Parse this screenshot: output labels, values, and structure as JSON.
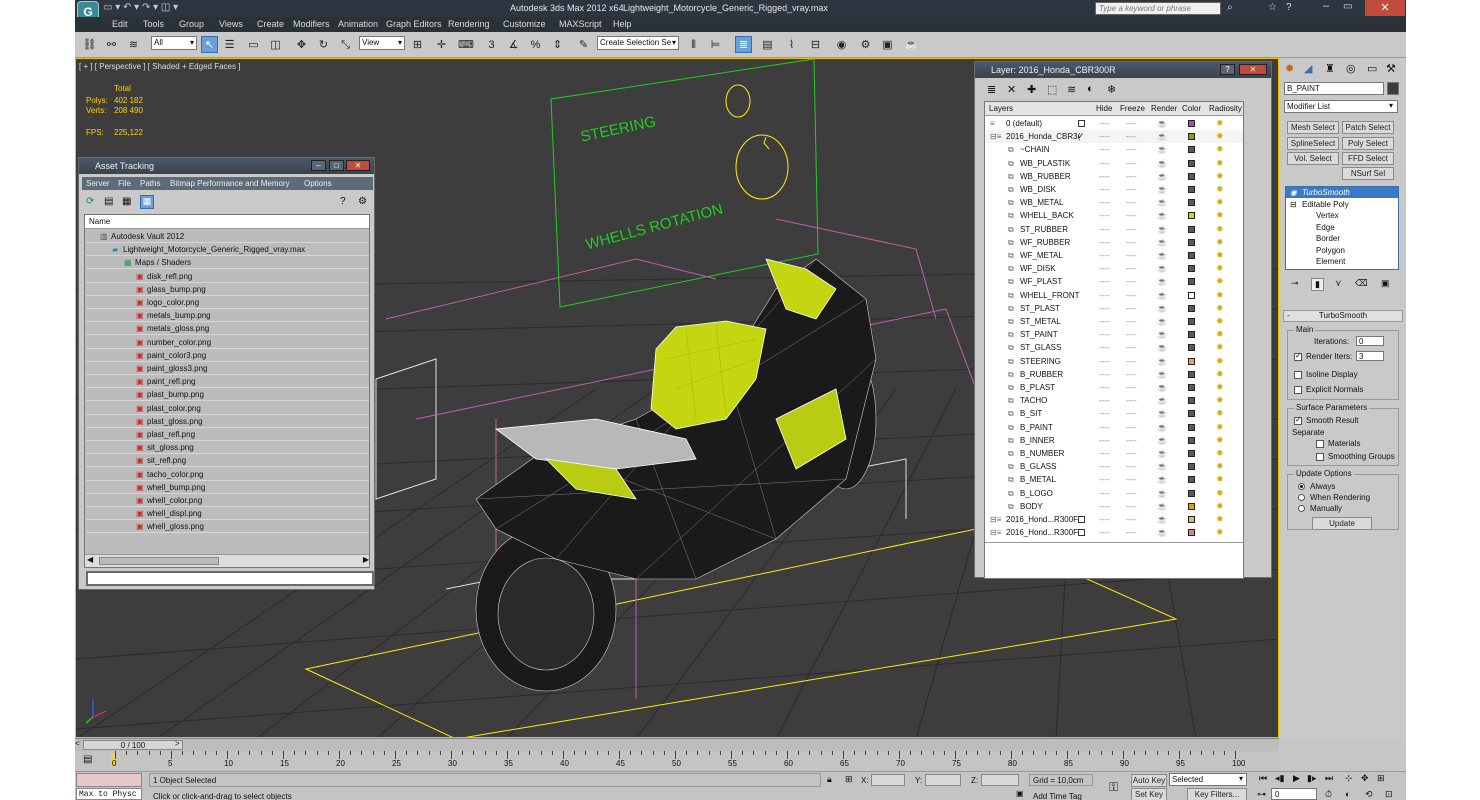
{
  "titlebar": {
    "app_title": "Autodesk 3ds Max  2012 x64",
    "file_title": "Lightweight_Motorcycle_Generic_Rigged_vray.max",
    "search_placeholder": "Type a keyword or phrase"
  },
  "menu": [
    "Edit",
    "Tools",
    "Group",
    "Views",
    "Create",
    "Modifiers",
    "Animation",
    "Graph Editors",
    "Rendering",
    "Customize",
    "MAXScript",
    "Help"
  ],
  "toolbar": {
    "selection_filter": "All",
    "ref_coord": "View",
    "named_selection": "Create Selection Se"
  },
  "viewport": {
    "label": "[ + ] [ Perspective ] [ Shaded + Edged Faces ]",
    "stats_header": "Total",
    "polys_label": "Polys:",
    "polys_value": "402 182",
    "verts_label": "Verts:",
    "verts_value": "208 490",
    "fps_label": "FPS:",
    "fps_value": "225,122",
    "text_steering": "STEERING",
    "text_wheels": "WHELLS ROTATION"
  },
  "asset_tracking": {
    "title": "Asset Tracking",
    "menu": [
      "Server",
      "File",
      "Paths",
      "Bitmap Performance and Memory",
      "Options"
    ],
    "column_name": "Name",
    "vault": "Autodesk Vault 2012",
    "file": "Lightweight_Motorcycle_Generic_Rigged_vray.max",
    "folder": "Maps / Shaders",
    "maps": [
      "disk_refl.png",
      "glass_bump.png",
      "logo_color.png",
      "metals_bump.png",
      "metals_gloss.png",
      "number_color.png",
      "paint_color3.png",
      "paint_gloss3.png",
      "paint_refl.png",
      "plast_bump.png",
      "plast_color.png",
      "plast_gloss.png",
      "plast_refl.png",
      "sit_gloss.png",
      "sit_refl.png",
      "tacho_color.png",
      "whell_bump.png",
      "whell_color.png",
      "whell_displ.png",
      "whell_gloss.png"
    ]
  },
  "layer_window": {
    "title": "Layer: 2016_Honda_CBR300R",
    "columns": [
      "Layers",
      "Hide",
      "Freeze",
      "Render",
      "Color",
      "Radiosity"
    ],
    "layers": [
      {
        "name": "0 (default)",
        "indent": 0,
        "color": "#c040c0",
        "check": true
      },
      {
        "name": "2016_Honda_CBR3(",
        "indent": 0,
        "color": "#8a9a20",
        "check": false,
        "current": true
      },
      {
        "name": "~CHAIN",
        "indent": 1,
        "color": "#5a5a5a"
      },
      {
        "name": "WB_PLASTIK",
        "indent": 1,
        "color": "#5a5a5a"
      },
      {
        "name": "WB_RUBBER",
        "indent": 1,
        "color": "#5a5a5a"
      },
      {
        "name": "WB_DISK",
        "indent": 1,
        "color": "#5a5a5a"
      },
      {
        "name": "WB_METAL",
        "indent": 1,
        "color": "#5a5a5a"
      },
      {
        "name": "WHELL_BACK",
        "indent": 1,
        "color": "#b8e800"
      },
      {
        "name": "ST_RUBBER",
        "indent": 1,
        "color": "#5a5a5a"
      },
      {
        "name": "WF_RUBBER",
        "indent": 1,
        "color": "#5a5a5a"
      },
      {
        "name": "WF_METAL",
        "indent": 1,
        "color": "#5a5a5a"
      },
      {
        "name": "WF_DISK",
        "indent": 1,
        "color": "#5a5a5a"
      },
      {
        "name": "WF_PLAST",
        "indent": 1,
        "color": "#5a5a5a"
      },
      {
        "name": "WHELL_FRONT",
        "indent": 1,
        "color": "#ffffff"
      },
      {
        "name": "ST_PLAST",
        "indent": 1,
        "color": "#5a5a5a"
      },
      {
        "name": "ST_METAL",
        "indent": 1,
        "color": "#5a5a5a"
      },
      {
        "name": "ST_PAINT",
        "indent": 1,
        "color": "#5a5a5a"
      },
      {
        "name": "ST_GLASS",
        "indent": 1,
        "color": "#5a5a5a"
      },
      {
        "name": "STEERING",
        "indent": 1,
        "color": "#e0a070"
      },
      {
        "name": "B_RUBBER",
        "indent": 1,
        "color": "#5a5a5a"
      },
      {
        "name": "B_PLAST",
        "indent": 1,
        "color": "#5a5a5a"
      },
      {
        "name": "TACHO",
        "indent": 1,
        "color": "#5a5a5a"
      },
      {
        "name": "B_SIT",
        "indent": 1,
        "color": "#5a5a5a"
      },
      {
        "name": "B_PAINT",
        "indent": 1,
        "color": "#5a5a5a"
      },
      {
        "name": "B_INNER",
        "indent": 1,
        "color": "#5a5a5a"
      },
      {
        "name": "B_NUMBER",
        "indent": 1,
        "color": "#5a5a5a"
      },
      {
        "name": "B_GLASS",
        "indent": 1,
        "color": "#5a5a5a"
      },
      {
        "name": "B_METAL",
        "indent": 1,
        "color": "#5a5a5a"
      },
      {
        "name": "B_LOGO",
        "indent": 1,
        "color": "#5a5a5a"
      },
      {
        "name": "BODY",
        "indent": 1,
        "color": "#e0a000"
      },
      {
        "name": "2016_Hond...R300F",
        "indent": 0,
        "color": "#d0c060",
        "check": true
      },
      {
        "name": "2016_Hond...R300F",
        "indent": 0,
        "color": "#e08080",
        "check": true
      }
    ]
  },
  "command_panel": {
    "object_name": "B_PAINT",
    "modifier_list": "Modifier List",
    "buttons": [
      "Mesh Select",
      "Patch Select",
      "SplineSelect",
      "Poly Select",
      "Vol. Select",
      "FFD Select",
      "NSurf Sel"
    ],
    "stack": [
      {
        "label": "TurboSmooth",
        "level": 0,
        "selected": true
      },
      {
        "label": "Editable Poly",
        "level": 0
      },
      {
        "label": "Vertex",
        "level": 1
      },
      {
        "label": "Edge",
        "level": 1
      },
      {
        "label": "Border",
        "level": 1
      },
      {
        "label": "Polygon",
        "level": 1
      },
      {
        "label": "Element",
        "level": 1
      }
    ],
    "rollout_title": "TurboSmooth",
    "main_label": "Main",
    "iterations_label": "Iterations:",
    "iterations_value": "0",
    "render_iters_label": "Render Iters:",
    "render_iters_value": "3",
    "isoline_label": "Isoline Display",
    "explicit_label": "Explicit Normals",
    "surface_label": "Surface Parameters",
    "smooth_label": "Smooth Result",
    "separate_label": "Separate",
    "materials_label": "Materials",
    "smoothing_label": "Smoothing Groups",
    "update_label": "Update Options",
    "always_label": "Always",
    "when_render_label": "When Rendering",
    "manually_label": "Manually",
    "update_button": "Update"
  },
  "timeline": {
    "frame_counter": "0 / 100",
    "ticks": [
      "0",
      "5",
      "10",
      "15",
      "20",
      "25",
      "30",
      "35",
      "40",
      "45",
      "50",
      "55",
      "60",
      "65",
      "70",
      "75",
      "80",
      "85",
      "90",
      "95",
      "100"
    ]
  },
  "status": {
    "maxscript": "Max to Physc",
    "selected": "1 Object Selected",
    "prompt": "Click or click-and-drag to select objects",
    "x_label": "X:",
    "y_label": "Y:",
    "z_label": "Z:",
    "grid": "Grid = 10,0cm",
    "add_time_tag": "Add Time Tag",
    "auto_key": "Auto Key",
    "auto_key_value": "Selected",
    "set_key": "Set Key",
    "key_filters": "Key Filters...",
    "frame_value": "0"
  }
}
